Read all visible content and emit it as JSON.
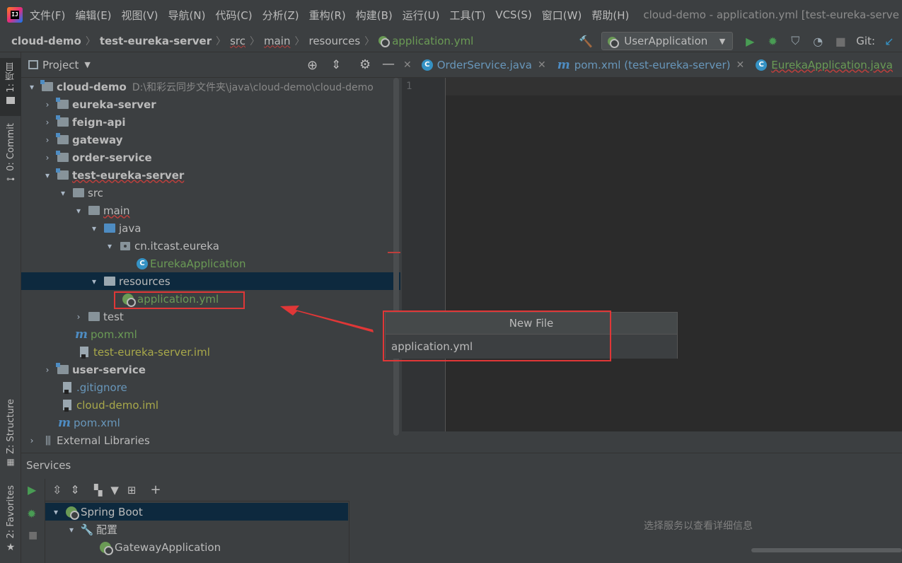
{
  "menubar": {
    "items": [
      "文件(F)",
      "编辑(E)",
      "视图(V)",
      "导航(N)",
      "代码(C)",
      "分析(Z)",
      "重构(R)",
      "构建(B)",
      "运行(U)",
      "工具(T)",
      "VCS(S)",
      "窗口(W)",
      "帮助(H)"
    ],
    "window_title": "cloud-demo - application.yml [test-eureka-serve"
  },
  "breadcrumb": [
    "cloud-demo",
    "test-eureka-server",
    "src",
    "main",
    "resources",
    "application.yml"
  ],
  "toolbar": {
    "run_config": "UserApplication",
    "git_label": "Git:"
  },
  "left_strip": {
    "project_tab": "1: 项目",
    "commit_tab": "0: Commit",
    "structure_tab": "Z: Structure",
    "favorites_tab": "2: Favorites"
  },
  "project_panel": {
    "title": "Project",
    "tree": [
      {
        "label": "cloud-demo",
        "path": "D:\\和彩云同步文件夹\\java\\cloud-demo\\cloud-demo"
      },
      {
        "label": "eureka-server"
      },
      {
        "label": "feign-api"
      },
      {
        "label": "gateway"
      },
      {
        "label": "order-service"
      },
      {
        "label": "test-eureka-server"
      },
      {
        "label": "src"
      },
      {
        "label": "main"
      },
      {
        "label": "java"
      },
      {
        "label": "cn.itcast.eureka"
      },
      {
        "label": "EurekaApplication"
      },
      {
        "label": "resources"
      },
      {
        "label": "application.yml"
      },
      {
        "label": "test"
      },
      {
        "label": "pom.xml"
      },
      {
        "label": "test-eureka-server.iml"
      },
      {
        "label": "user-service"
      },
      {
        "label": ".gitignore"
      },
      {
        "label": "cloud-demo.iml"
      },
      {
        "label": "pom.xml"
      },
      {
        "label": "External Libraries"
      }
    ]
  },
  "editor": {
    "tabs": [
      "OrderService.java",
      "pom.xml (test-eureka-server)",
      "EurekaApplication.java"
    ],
    "line_numbers": [
      "1"
    ]
  },
  "popup": {
    "title": "New File",
    "value": "application.yml"
  },
  "services": {
    "title": "Services",
    "tree": [
      "Spring Boot",
      "配置",
      "GatewayApplication"
    ],
    "empty_text": "选择服务以查看详细信息"
  },
  "colors": {
    "background": "#3c3f41",
    "editor_bg": "#2b2b2b",
    "selection": "#0d293e",
    "annotation_red": "#e03737",
    "spring_green": "#6a9a55"
  }
}
